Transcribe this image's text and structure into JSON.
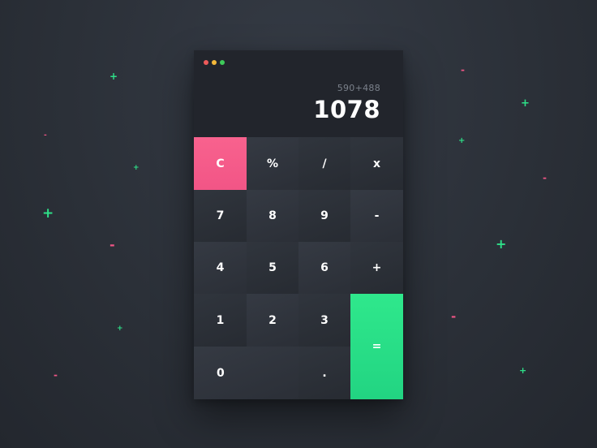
{
  "window_controls": {
    "close_color": "#ee5a5a",
    "minimize_color": "#f5b93a",
    "maximize_color": "#3ecb5a"
  },
  "display": {
    "expression": "590+488",
    "result": "1078"
  },
  "keys": {
    "clear": "C",
    "percent": "%",
    "divide": "/",
    "multiply": "x",
    "seven": "7",
    "eight": "8",
    "nine": "9",
    "subtract": "-",
    "four": "4",
    "five": "5",
    "six": "6",
    "add": "+",
    "one": "1",
    "two": "2",
    "three": "3",
    "equals": "=",
    "zero": "0",
    "decimal": "."
  },
  "colors": {
    "clear_key": "#f65a89",
    "equals_key": "#28de87",
    "plus_decoration": "#2ee088",
    "minus_decoration": "#ee5585"
  },
  "decorations": {
    "plus": "+",
    "minus": "-"
  }
}
